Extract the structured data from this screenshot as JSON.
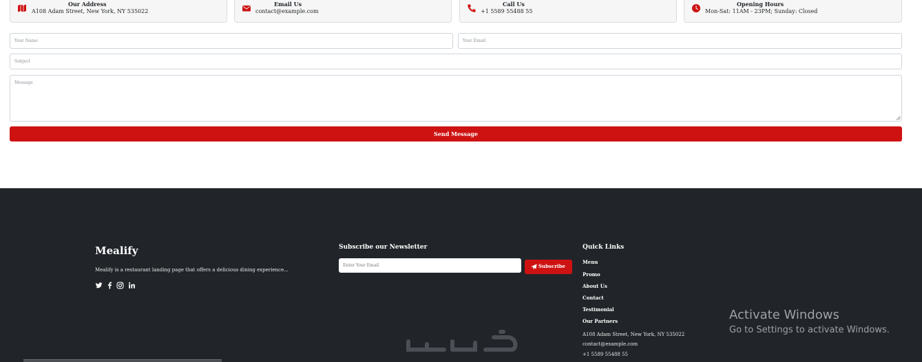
{
  "info_cards": [
    {
      "title": "Our Address",
      "value": "A108 Adam Street, New York, NY 535022",
      "icon": "map-icon"
    },
    {
      "title": "Email Us",
      "value": "contact@example.com",
      "icon": "envelope-icon"
    },
    {
      "title": "Call Us",
      "value": "+1 5589 55488 55",
      "icon": "phone-icon"
    },
    {
      "title": "Opening Hours",
      "value": "Mon-Sat: 11AM - 23PM; Sunday: Closed",
      "icon": "clock-icon"
    }
  ],
  "form": {
    "name_placeholder": "Your Name",
    "email_placeholder": "Your Email",
    "subject_placeholder": "Subject",
    "message_placeholder": "Message",
    "submit_label": "Send Message"
  },
  "footer": {
    "brand": "Mealify",
    "tagline": "Mealify is a restaurant landing page that offers a delicious dining experience...",
    "socials": [
      "twitter-icon",
      "facebook-icon",
      "instagram-icon",
      "linkedin-icon"
    ],
    "newsletter": {
      "heading": "Subscribe our Newsletter",
      "placeholder": "Enter Your Email",
      "button_label": "Subscribe"
    },
    "quick_links": {
      "heading": "Quick Links",
      "items": [
        "Menu",
        "Promo",
        "About Us",
        "Contact",
        "Testimonial",
        "Our Partners"
      ]
    },
    "contact": {
      "address": "A108 Adam Street, New York, NY 535022",
      "email": "contact@example.com",
      "phone": "+1 5589 55488 55"
    }
  },
  "os_overlay": {
    "title": "Activate Windows",
    "subtitle": "Go to Settings to activate Windows."
  },
  "colors": {
    "accent": "#ce1212",
    "footer_bg": "#212529"
  }
}
